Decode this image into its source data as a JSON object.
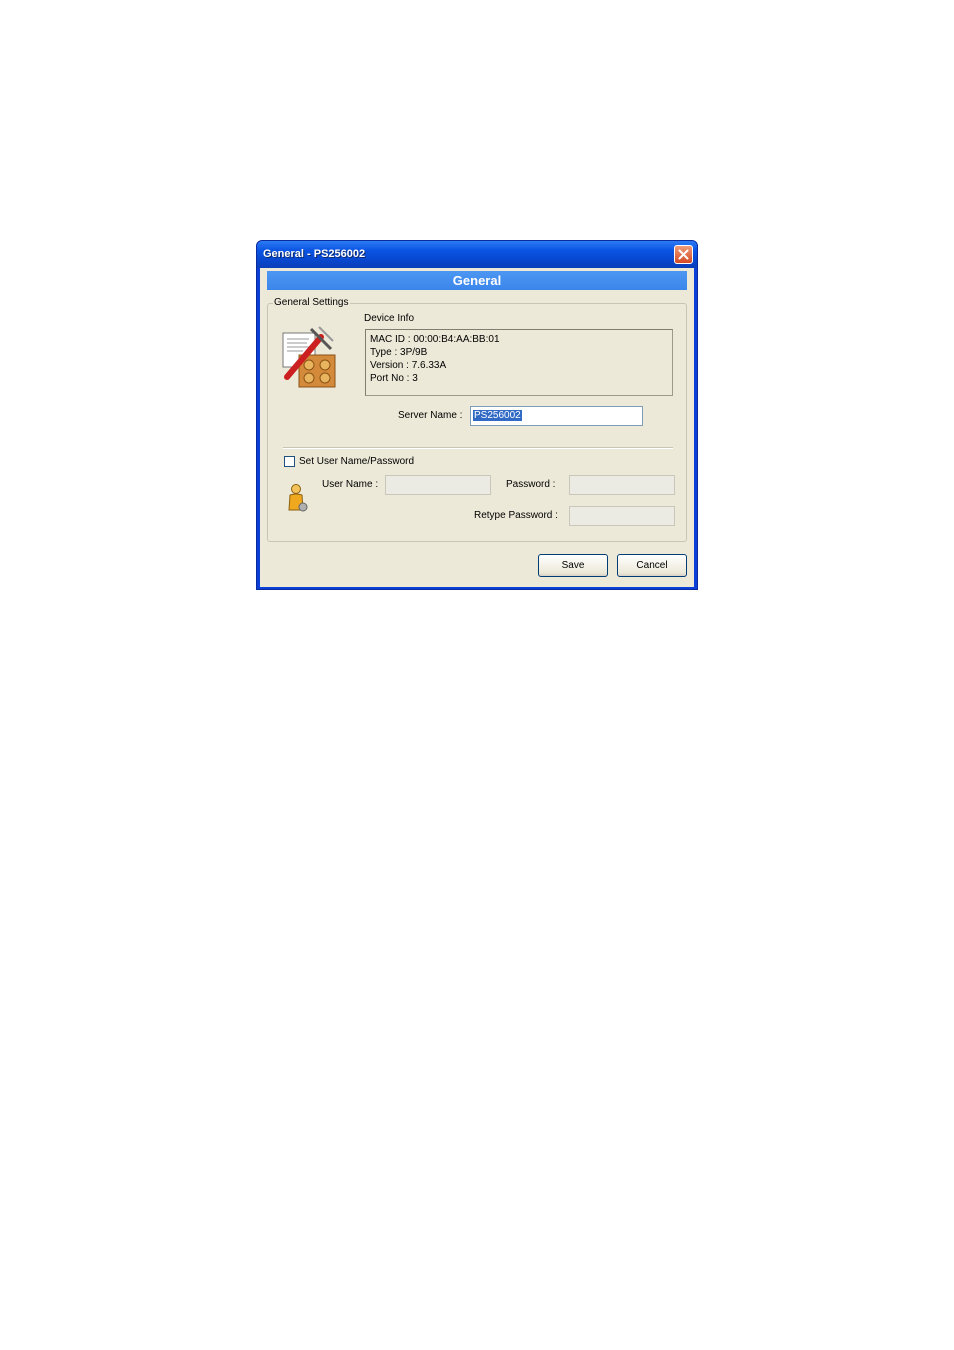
{
  "window": {
    "title": "General - PS256002",
    "banner": "General"
  },
  "general_settings": {
    "group_label": "General Settings",
    "device_info_label": "Device Info",
    "device_info": {
      "mac_id": "MAC ID : 00:00:B4:AA:BB:01",
      "type": "Type : 3P/9B",
      "version": "Version : 7.6.33A",
      "port_no": "Port No : 3"
    },
    "server_name_label": "Server Name :",
    "server_name_value": "PS256002"
  },
  "credentials": {
    "checkbox_label": "Set User Name/Password",
    "checkbox_checked": false,
    "user_name_label": "User Name :",
    "user_name_value": "",
    "password_label": "Password :",
    "password_value": "",
    "retype_password_label": "Retype Password :",
    "retype_password_value": ""
  },
  "buttons": {
    "save": "Save",
    "cancel": "Cancel"
  },
  "icons": {
    "settings": "settings-tools-icon",
    "user": "user-icon",
    "close": "close-icon"
  },
  "colors": {
    "titlebar": "#0a54e3",
    "banner": "#4c97f2",
    "dialog_background": "#ece9d8",
    "selection": "#316ac5"
  }
}
